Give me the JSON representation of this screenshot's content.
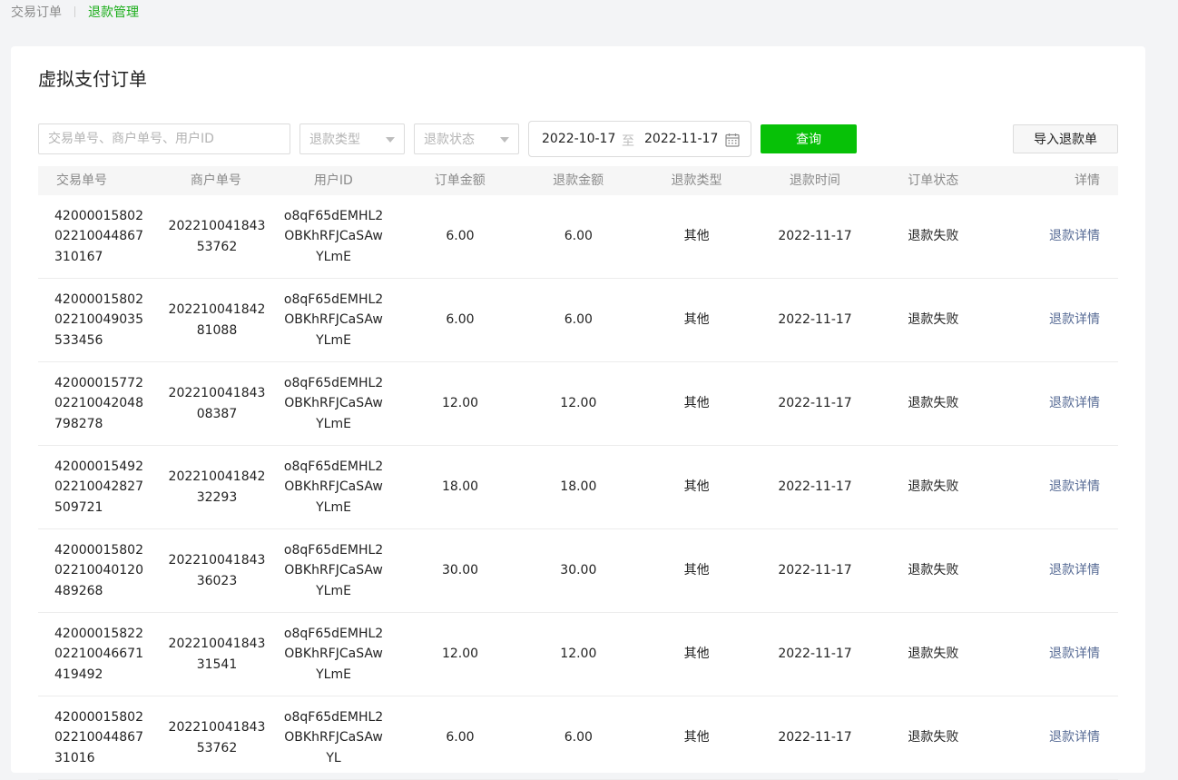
{
  "tabs": [
    {
      "label": "交易订单",
      "active": false
    },
    {
      "label": "退款管理",
      "active": true
    }
  ],
  "page_title": "虚拟支付订单",
  "filters": {
    "search_placeholder": "交易单号、商户单号、用户ID",
    "refund_type_placeholder": "退款类型",
    "refund_status_placeholder": "退款状态",
    "date_start": "2022-10-17",
    "date_separator": "至",
    "date_end": "2022-11-17",
    "query_label": "查询",
    "import_label": "导入退款单"
  },
  "table": {
    "headers": [
      "交易单号",
      "商户单号",
      "用户ID",
      "订单金额",
      "退款金额",
      "退款类型",
      "退款时间",
      "订单状态",
      "详情"
    ],
    "rows": [
      {
        "trade_no": "4200001580202210044867310167",
        "merchant_no": "20221004184353762",
        "user_id": "o8qF65dEMHL2OBKhRFJCaSAwYLmE",
        "order_amount": "6.00",
        "refund_amount": "6.00",
        "refund_type": "其他",
        "refund_time": "2022-11-17",
        "status": "退款失败",
        "detail": "退款详情"
      },
      {
        "trade_no": "4200001580202210049035533456",
        "merchant_no": "20221004184281088",
        "user_id": "o8qF65dEMHL2OBKhRFJCaSAwYLmE",
        "order_amount": "6.00",
        "refund_amount": "6.00",
        "refund_type": "其他",
        "refund_time": "2022-11-17",
        "status": "退款失败",
        "detail": "退款详情"
      },
      {
        "trade_no": "4200001577202210042048798278",
        "merchant_no": "20221004184308387",
        "user_id": "o8qF65dEMHL2OBKhRFJCaSAwYLmE",
        "order_amount": "12.00",
        "refund_amount": "12.00",
        "refund_type": "其他",
        "refund_time": "2022-11-17",
        "status": "退款失败",
        "detail": "退款详情"
      },
      {
        "trade_no": "4200001549202210042827509721",
        "merchant_no": "20221004184232293",
        "user_id": "o8qF65dEMHL2OBKhRFJCaSAwYLmE",
        "order_amount": "18.00",
        "refund_amount": "18.00",
        "refund_type": "其他",
        "refund_time": "2022-11-17",
        "status": "退款失败",
        "detail": "退款详情"
      },
      {
        "trade_no": "4200001580202210040120489268",
        "merchant_no": "20221004184336023",
        "user_id": "o8qF65dEMHL2OBKhRFJCaSAwYLmE",
        "order_amount": "30.00",
        "refund_amount": "30.00",
        "refund_type": "其他",
        "refund_time": "2022-11-17",
        "status": "退款失败",
        "detail": "退款详情"
      },
      {
        "trade_no": "4200001582202210046671419492",
        "merchant_no": "20221004184331541",
        "user_id": "o8qF65dEMHL2OBKhRFJCaSAwYLmE",
        "order_amount": "12.00",
        "refund_amount": "12.00",
        "refund_type": "其他",
        "refund_time": "2022-11-17",
        "status": "退款失败",
        "detail": "退款详情"
      },
      {
        "trade_no": "420000158020221004486731016",
        "merchant_no": "20221004184353762",
        "user_id": "o8qF65dEMHL2OBKhRFJCaSAwYL",
        "order_amount": "6.00",
        "refund_amount": "6.00",
        "refund_type": "其他",
        "refund_time": "2022-11-17",
        "status": "退款失败",
        "detail": "退款详情"
      }
    ]
  },
  "colors": {
    "accent_green": "#07c107",
    "tab_active": "#1aad19",
    "link": "#576b95"
  },
  "icons": {
    "calendar": "calendar-icon",
    "caret": "chevron-down-icon"
  }
}
